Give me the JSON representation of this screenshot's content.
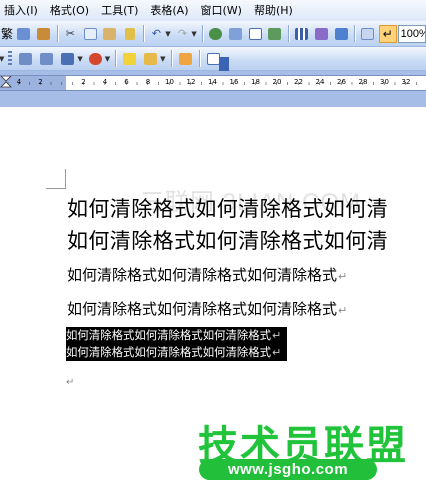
{
  "menu": {
    "items": [
      "插入(I)",
      "格式(O)",
      "工具(T)",
      "表格(A)",
      "窗口(W)",
      "帮助(H)"
    ]
  },
  "toolbar": {
    "simplified_traditional": "繁",
    "zoom_value": "100%",
    "accent": "#ffd27a"
  },
  "ruler": {
    "labels": [
      "4",
      "2",
      "",
      "2",
      "4",
      "6",
      "8",
      "10",
      "12",
      "14",
      "16",
      "18",
      "20",
      "22",
      "24",
      "26",
      "28",
      "30",
      "32"
    ]
  },
  "document": {
    "lines_big": [
      "如何清除格式如何清除格式如何清",
      "如何清除格式如何清除格式如何清"
    ],
    "lines_mid": [
      "如何清除格式如何清除格式如何清除格式",
      "如何清除格式如何清除格式如何清除格式"
    ],
    "lines_selected": [
      "如何清除格式如何清除格式如何清除格式",
      "如何清除格式如何清除格式如何清除格式"
    ],
    "para_mark": "↵",
    "watermark_text": "三联网 3LIAN.COM",
    "logo_text": "技术员联盟",
    "logo_url": "www.jsgho.com"
  }
}
